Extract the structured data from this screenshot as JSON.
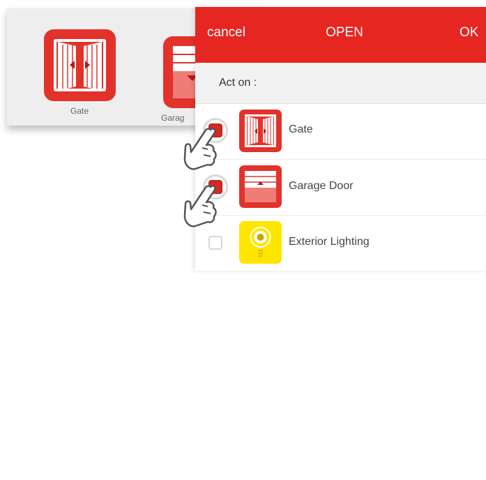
{
  "background_card": {
    "tiles": [
      {
        "label": "Gate",
        "icon": "gate-icon"
      },
      {
        "label": "Garag",
        "icon": "garage-door-icon"
      }
    ]
  },
  "dialog": {
    "cancel_label": "cancel",
    "title": "OPEN",
    "ok_label": "OK",
    "act_on_label": "Act on :",
    "items": [
      {
        "label": "Gate",
        "icon": "gate-icon",
        "checked": true
      },
      {
        "label": "Garage Door",
        "icon": "garage-door-icon",
        "checked": true
      },
      {
        "label": "Exterior Lighting",
        "icon": "light-bulb-icon",
        "checked": false
      }
    ]
  },
  "colors": {
    "accent": "#e52621",
    "gate_icon_bg": "#e2322b",
    "light_icon_bg": "#ffe500",
    "act_on_bg": "#f2f2f2"
  }
}
